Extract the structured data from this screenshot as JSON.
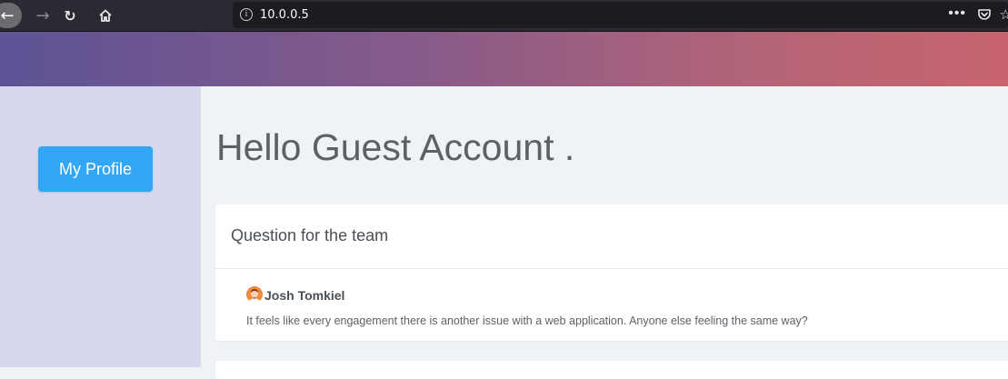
{
  "browser": {
    "url": "10.0.0.5",
    "more_label": "•••"
  },
  "sidebar": {
    "profile_button_label": "My Profile"
  },
  "main": {
    "greeting": "Hello Guest Account .",
    "card": {
      "title": "Question for the team",
      "author": "Josh Tomkiel",
      "body": "It feels like every engagement there is another issue with a web application. Anyone else feeling the same way?"
    }
  },
  "colors": {
    "gradient_start": "#5d5396",
    "gradient_end": "#c8646e",
    "sidebar_bg": "#d6d8ee",
    "button_blue": "#33a6f5"
  }
}
